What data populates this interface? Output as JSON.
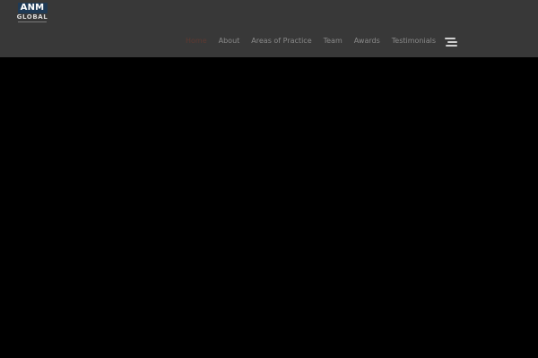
{
  "logo": {
    "top_text": "ANM",
    "bottom_text": "GLOBAL"
  },
  "nav": {
    "items": [
      {
        "label": "Home",
        "active": true
      },
      {
        "label": "About",
        "active": false
      },
      {
        "label": "Areas of Practice",
        "active": false
      },
      {
        "label": "Team",
        "active": false
      },
      {
        "label": "Awards",
        "active": false
      },
      {
        "label": "Testimonials",
        "active": false
      }
    ]
  },
  "menu": {
    "icon": "hamburger-menu-icon"
  },
  "colors": {
    "header_bg": "#383838",
    "page_bg": "#000000",
    "nav_text": "#8a8a8a",
    "nav_active": "#5e3a32",
    "logo_blue": "#1f3a55"
  }
}
